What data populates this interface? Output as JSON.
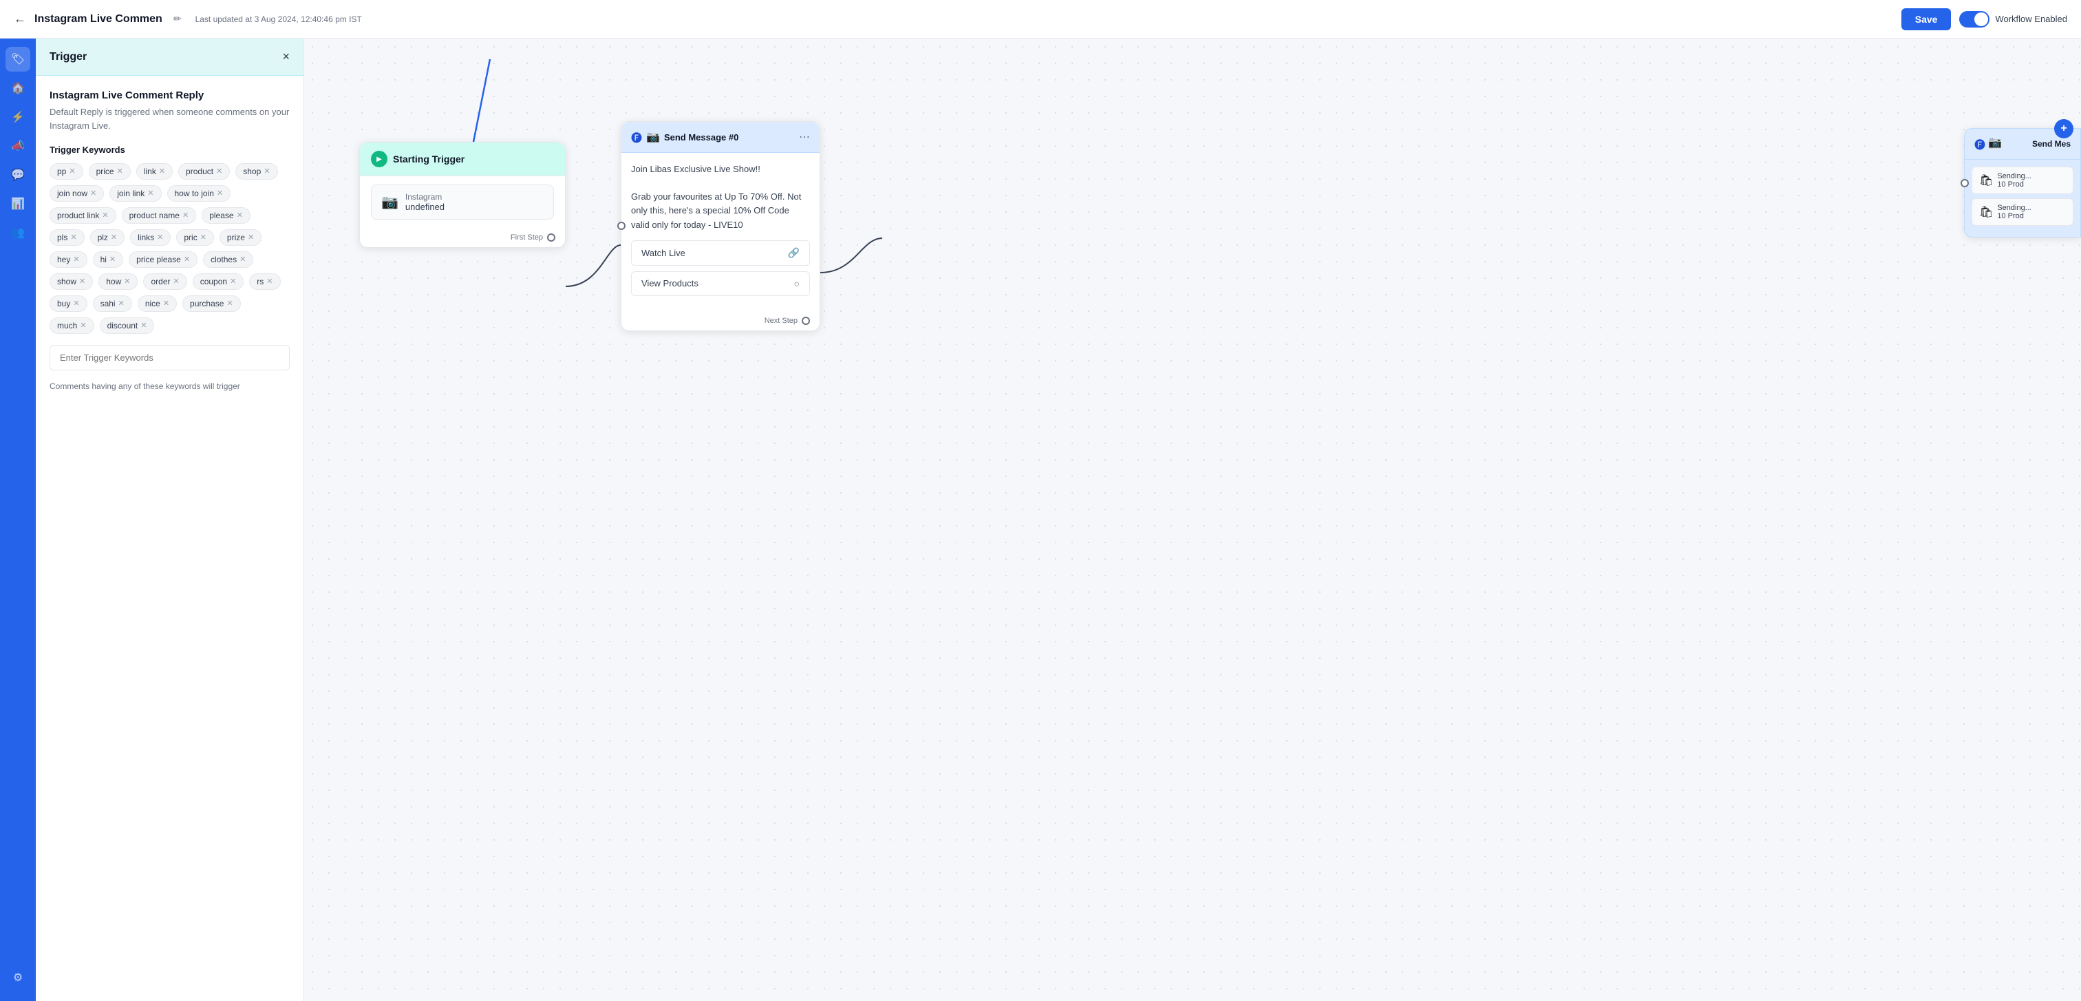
{
  "header": {
    "back_label": "←",
    "title": "Instagram Live Commen",
    "edit_icon": "✏",
    "timestamp": "Last updated at 3 Aug 2024, 12:40:46 pm IST",
    "save_label": "Save",
    "toggle_label": "Workflow Enabled"
  },
  "sidebar": {
    "icons": [
      {
        "name": "logo-icon",
        "symbol": "🏷"
      },
      {
        "name": "home-icon",
        "symbol": "🏠"
      },
      {
        "name": "lightning-icon",
        "symbol": "⚡"
      },
      {
        "name": "megaphone-icon",
        "symbol": "📣"
      },
      {
        "name": "chat-icon",
        "symbol": "💬"
      },
      {
        "name": "chart-icon",
        "symbol": "📊"
      },
      {
        "name": "people-icon",
        "symbol": "👥"
      },
      {
        "name": "settings-icon",
        "symbol": "⚙"
      }
    ]
  },
  "left_panel": {
    "trigger_header": "Trigger",
    "close_label": "×",
    "trigger_name": "Instagram Live Comment Reply",
    "trigger_desc": "Default Reply is triggered when someone comments on your Instagram Live.",
    "keywords_label": "Trigger Keywords",
    "keywords": [
      "pp",
      "price",
      "link",
      "product",
      "shop",
      "join now",
      "join link",
      "how to join",
      "product link",
      "product name",
      "please",
      "pls",
      "plz",
      "links",
      "pric",
      "prize",
      "hey",
      "hi",
      "price please",
      "clothes",
      "show",
      "how",
      "order",
      "coupon",
      "rs",
      "buy",
      "sahi",
      "nice",
      "purchase",
      "much",
      "discount"
    ],
    "keyword_input_placeholder": "Enter Trigger Keywords",
    "footer_text": "Comments having any of these keywords will trigger"
  },
  "starting_trigger": {
    "header": "Starting Trigger",
    "platform": "Instagram",
    "value": "undefined",
    "first_step_label": "First Step"
  },
  "send_message_0": {
    "title": "Send Message #0",
    "message_text": "Join Libas Exclusive Live Show!!\n\nGrab your favourites at Up To 70% Off. Not only this, here's a special 10% Off Code valid only for today - LIVE10",
    "btn_watch_live": "Watch Live",
    "btn_view_products": "View Products",
    "next_step_label": "Next Step"
  },
  "send_message_partial": {
    "title": "Send Mes",
    "add_icon": "+",
    "sending_rows": [
      {
        "icon": "🛍",
        "text": "Sending...",
        "sub": "10 Prod"
      },
      {
        "icon": "🛍",
        "text": "Sending...",
        "sub": "10 Prod"
      }
    ]
  }
}
